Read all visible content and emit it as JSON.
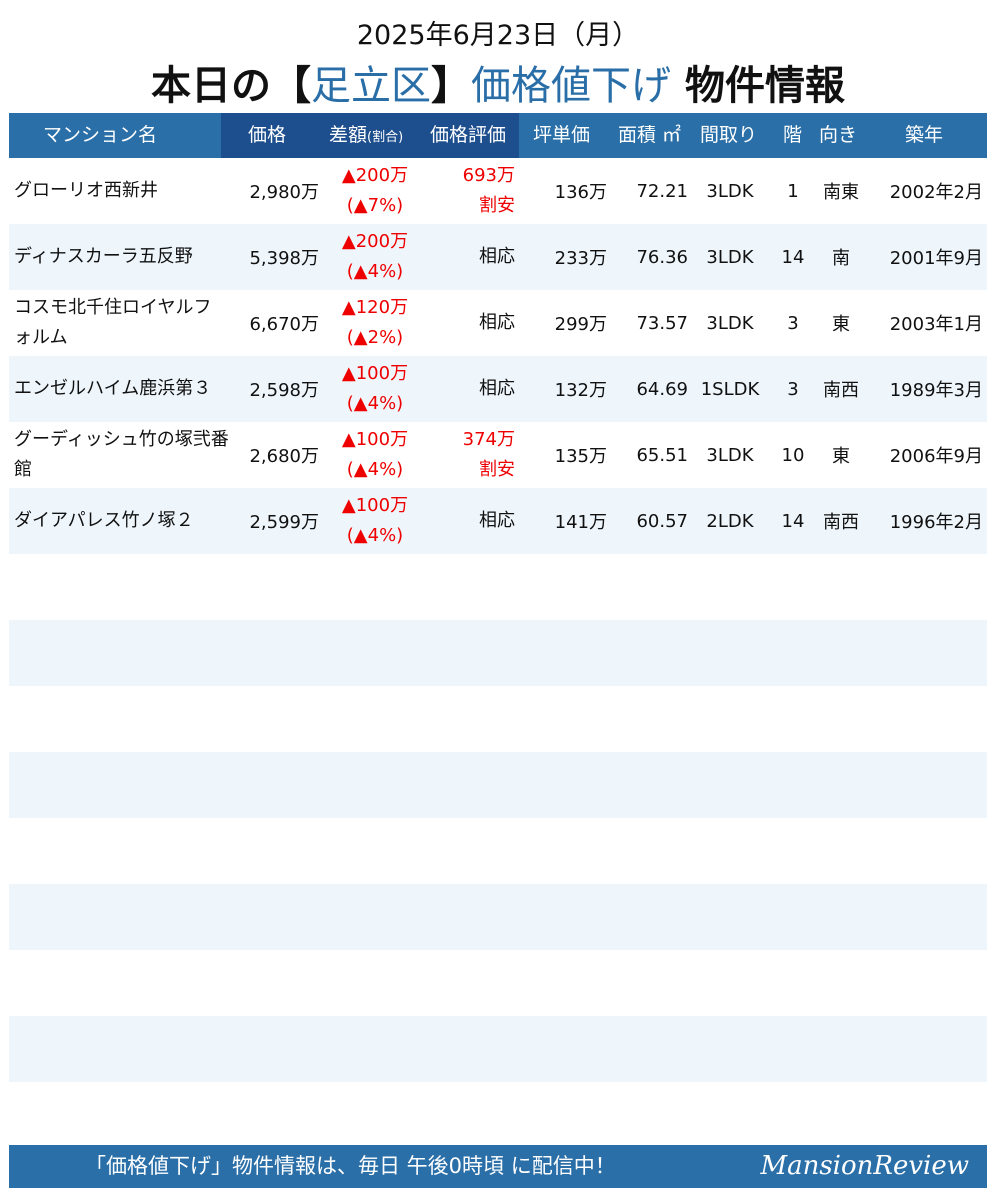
{
  "header": {
    "date": "2025年6月23日（月）",
    "title_prefix": "本日の【",
    "ward": "足立区",
    "title_mid": "】",
    "title_accent": "価格値下げ",
    "title_suffix": " 物件情報"
  },
  "columns": {
    "name": "マンション名",
    "price": "価格",
    "diff": "差額",
    "diff_small": "(割合)",
    "eval": "価格評価",
    "unit": "坪単価",
    "area": "面積 ㎡",
    "layout": "間取り",
    "floor": "階",
    "dir": "向き",
    "built": "築年"
  },
  "rows": [
    {
      "name": "グローリオ西新井",
      "price": "2,980万",
      "diff": "▲200万",
      "ratio": "(▲7%)",
      "eval1": "693万",
      "eval2": "割安",
      "eval_red": true,
      "unit": "136万",
      "area": "72.21",
      "layout": "3LDK",
      "floor": "1",
      "dir": "南東",
      "built": "2002年2月"
    },
    {
      "name": "ディナスカーラ五反野",
      "price": "5,398万",
      "diff": "▲200万",
      "ratio": "(▲4%)",
      "eval1": "相応",
      "eval2": "",
      "eval_red": false,
      "unit": "233万",
      "area": "76.36",
      "layout": "3LDK",
      "floor": "14",
      "dir": "南",
      "built": "2001年9月"
    },
    {
      "name": "コスモ北千住ロイヤルフォルム",
      "price": "6,670万",
      "diff": "▲120万",
      "ratio": "(▲2%)",
      "eval1": "相応",
      "eval2": "",
      "eval_red": false,
      "unit": "299万",
      "area": "73.57",
      "layout": "3LDK",
      "floor": "3",
      "dir": "東",
      "built": "2003年1月"
    },
    {
      "name": "エンゼルハイム鹿浜第３",
      "price": "2,598万",
      "diff": "▲100万",
      "ratio": "(▲4%)",
      "eval1": "相応",
      "eval2": "",
      "eval_red": false,
      "unit": "132万",
      "area": "64.69",
      "layout": "1SLDK",
      "floor": "3",
      "dir": "南西",
      "built": "1989年3月"
    },
    {
      "name": "グーディッシュ竹の塚弐番館",
      "price": "2,680万",
      "diff": "▲100万",
      "ratio": "(▲4%)",
      "eval1": "374万",
      "eval2": "割安",
      "eval_red": true,
      "unit": "135万",
      "area": "65.51",
      "layout": "3LDK",
      "floor": "10",
      "dir": "東",
      "built": "2006年9月"
    },
    {
      "name": "ダイアパレス竹ノ塚２",
      "price": "2,599万",
      "diff": "▲100万",
      "ratio": "(▲4%)",
      "eval1": "相応",
      "eval2": "",
      "eval_red": false,
      "unit": "141万",
      "area": "60.57",
      "layout": "2LDK",
      "floor": "14",
      "dir": "南西",
      "built": "1996年2月"
    }
  ],
  "empty_rows": 9,
  "footer": {
    "message": "「価格値下げ」物件情報は、毎日 午後0時頃 に配信中！",
    "logo": "MansionReview"
  },
  "colors": {
    "header_blue": "#2a6fa8",
    "header_dark_blue": "#1d4f8e",
    "accent_text": "#2a6ea8",
    "alert_red": "#ee0000",
    "row_shade": "#eef6fc"
  }
}
